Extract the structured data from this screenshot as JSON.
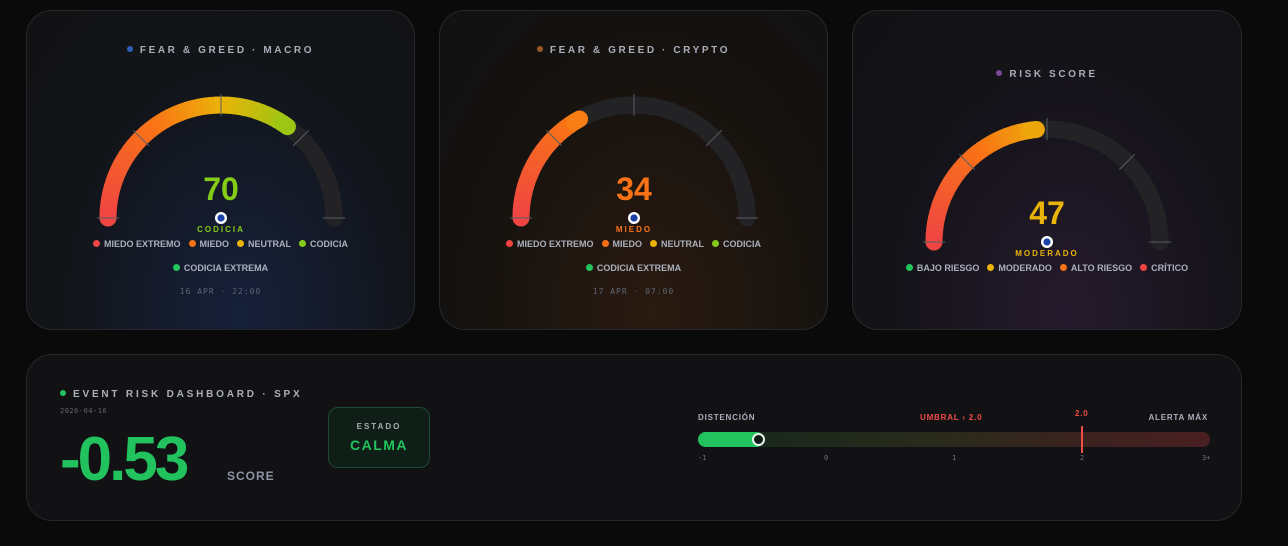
{
  "gauges": [
    {
      "title": "FEAR & GREED · MACRO",
      "dot_color": "#2f5fb8",
      "value": "70",
      "value_num": 70,
      "value_color": "#84cc16",
      "label": "CODICIA",
      "legend": [
        {
          "label": "MIEDO EXTREMO",
          "color": "#ef4444"
        },
        {
          "label": "MIEDO",
          "color": "#f97316"
        },
        {
          "label": "NEUTRAL",
          "color": "#eab308"
        },
        {
          "label": "CODICIA",
          "color": "#84cc16"
        },
        {
          "label": "CODICIA EXTREMA",
          "color": "#22c55e"
        }
      ],
      "timestamp": "16 APR · 22:00"
    },
    {
      "title": "FEAR & GREED · CRYPTO",
      "dot_color": "#9a5a2a",
      "value": "34",
      "value_num": 34,
      "value_color": "#f97316",
      "label": "MIEDO",
      "legend": [
        {
          "label": "MIEDO EXTREMO",
          "color": "#ef4444"
        },
        {
          "label": "MIEDO",
          "color": "#f97316"
        },
        {
          "label": "NEUTRAL",
          "color": "#eab308"
        },
        {
          "label": "CODICIA",
          "color": "#84cc16"
        },
        {
          "label": "CODICIA EXTREMA",
          "color": "#22c55e"
        }
      ],
      "timestamp": "17 APR · 07:00"
    },
    {
      "title": "RISK SCORE",
      "dot_color": "#7a4a9a",
      "value": "47",
      "value_num": 47,
      "value_color": "#eab308",
      "label": "MODERADO",
      "legend": [
        {
          "label": "BAJO RIESGO",
          "color": "#22c55e"
        },
        {
          "label": "MODERADO",
          "color": "#eab308"
        },
        {
          "label": "ALTO RIESGO",
          "color": "#f97316"
        },
        {
          "label": "CRÍTICO",
          "color": "#ef4444"
        }
      ],
      "timestamp": ""
    }
  ],
  "event": {
    "title": "EVENT RISK DASHBOARD · SPX",
    "date": "2026-04-16",
    "score": "-0.53",
    "score_value": -0.53,
    "score_label": "SCORE",
    "estado_label": "ESTADO",
    "estado_value": "CALMA",
    "bar": {
      "left_label": "DISTENCIÓN",
      "threshold_label": "UMBRAL › 2.0",
      "threshold_value_label": "2.0",
      "threshold": 2.0,
      "right_label": "ALERTA MÁX",
      "min": -1,
      "max": 3,
      "ticks": [
        "-1",
        "0",
        "1",
        "2",
        "3+"
      ]
    }
  }
}
